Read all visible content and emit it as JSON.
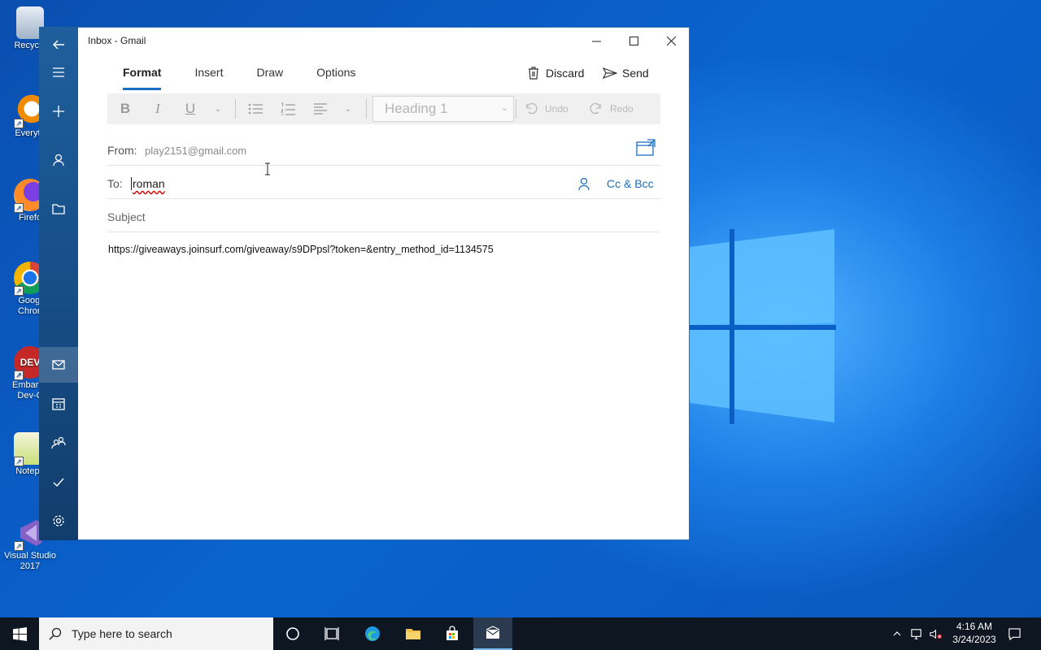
{
  "desktop": {
    "icons": [
      {
        "label": "Recycle",
        "name": "recycle-bin"
      },
      {
        "label": "Everyth",
        "name": "everything"
      },
      {
        "label": "Firefo",
        "name": "firefox"
      },
      {
        "label": "Googl\nChron",
        "name": "google-chrome"
      },
      {
        "label": "Embarca\nDev-C",
        "name": "embarcadero-dev-cpp"
      },
      {
        "label": "Notepa",
        "name": "notepad-plus-plus"
      },
      {
        "label": "Visual Studio\n2017",
        "name": "visual-studio-2017"
      }
    ]
  },
  "window": {
    "title": "Inbox - Gmail"
  },
  "tabs": [
    "Format",
    "Insert",
    "Draw",
    "Options"
  ],
  "actions": {
    "discard": "Discard",
    "send": "Send"
  },
  "toolbar": {
    "bold": "B",
    "italic": "I",
    "underline": "U",
    "style_value": "Heading 1",
    "undo": "Undo",
    "redo": "Redo"
  },
  "compose": {
    "from_label": "From:",
    "from_value": "play2151@gmail.com",
    "to_label": "To:",
    "to_value": "roman",
    "cc_bcc": "Cc & Bcc",
    "subject_placeholder": "Subject",
    "body": "https://giveaways.joinsurf.com/giveaway/s9DPpsl?token=&entry_method_id=1134575"
  },
  "taskbar": {
    "search_placeholder": "Type here to search",
    "time": "4:16 AM",
    "date": "3/24/2023"
  },
  "colors": {
    "accent": "#1a6fc4",
    "rail": "#17508a",
    "taskbar": "#0e1622"
  }
}
